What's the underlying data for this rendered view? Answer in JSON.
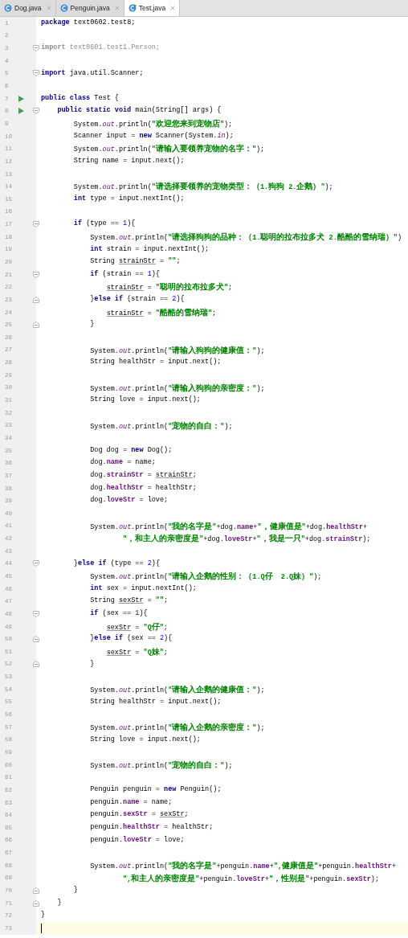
{
  "tabs": [
    {
      "label": "Dog.java",
      "selected": false,
      "kind": "class"
    },
    {
      "label": "Penguin.java",
      "selected": false,
      "kind": "class"
    },
    {
      "label": "Test.java",
      "selected": true,
      "kind": "runnable"
    }
  ],
  "lines": [
    {
      "n": "1",
      "current": false,
      "tokens": [
        {
          "kind": "kw",
          "text": "package"
        },
        {
          "kind": "p",
          "text": " text0602.test8;"
        }
      ]
    },
    {
      "n": "2",
      "current": false
    },
    {
      "n": "3",
      "current": false,
      "icons": [
        {
          "kind": "fold-start"
        }
      ],
      "tokens": [
        {
          "kind": "dimkw",
          "text": "import"
        },
        {
          "kind": "dim",
          "text": " text0601.test1.Person;"
        }
      ]
    },
    {
      "n": "4",
      "current": false
    },
    {
      "n": "5",
      "current": false,
      "icons": [
        {
          "kind": "fold-start"
        }
      ],
      "tokens": [
        {
          "kind": "kw",
          "text": "import"
        },
        {
          "kind": "p",
          "text": " java.util.Scanner;"
        }
      ]
    },
    {
      "n": "6",
      "current": false
    },
    {
      "n": "7",
      "current": false,
      "icons": [
        {
          "kind": "run"
        }
      ],
      "tokens": [
        {
          "kind": "kw",
          "text": "public class"
        },
        {
          "kind": "p",
          "text": " Test {"
        }
      ]
    },
    {
      "n": "8",
      "current": false,
      "icons": [
        {
          "kind": "run"
        },
        {
          "kind": "fold-start"
        }
      ],
      "tokens": [
        {
          "kind": "kw",
          "text": "    public static void"
        },
        {
          "kind": "p",
          "text": " main(String[] args) {"
        }
      ]
    },
    {
      "n": "9",
      "current": false,
      "tokens": [
        {
          "kind": "p",
          "text": "        System."
        },
        {
          "kind": "st",
          "text": "out"
        },
        {
          "kind": "p",
          "text": ".println("
        },
        {
          "kind": "str",
          "text": "\"欢迎您来到宠物店\""
        },
        {
          "kind": "p",
          "text": ");"
        }
      ]
    },
    {
      "n": "10",
      "current": false,
      "tokens": [
        {
          "kind": "p",
          "text": "        Scanner input = "
        },
        {
          "kind": "kw",
          "text": "new"
        },
        {
          "kind": "p",
          "text": " Scanner(System."
        },
        {
          "kind": "st",
          "text": "in"
        },
        {
          "kind": "p",
          "text": ");"
        }
      ]
    },
    {
      "n": "11",
      "current": false,
      "tokens": [
        {
          "kind": "p",
          "text": "        System."
        },
        {
          "kind": "st",
          "text": "out"
        },
        {
          "kind": "p",
          "text": ".println("
        },
        {
          "kind": "str",
          "text": "\"请输入要领养宠物的名字：\""
        },
        {
          "kind": "p",
          "text": ");"
        }
      ]
    },
    {
      "n": "12",
      "current": false,
      "tokens": [
        {
          "kind": "p",
          "text": "        String name = input.next();"
        }
      ]
    },
    {
      "n": "13",
      "current": false
    },
    {
      "n": "14",
      "current": false,
      "tokens": [
        {
          "kind": "p",
          "text": "        System."
        },
        {
          "kind": "st",
          "text": "out"
        },
        {
          "kind": "p",
          "text": ".println("
        },
        {
          "kind": "str",
          "text": "\"请选择要领养的宠物类型：（1.狗狗 2.企鹅）\""
        },
        {
          "kind": "p",
          "text": ");"
        }
      ]
    },
    {
      "n": "15",
      "current": false,
      "tokens": [
        {
          "kind": "kw",
          "text": "        int"
        },
        {
          "kind": "p",
          "text": " type = input.nextInt();"
        }
      ]
    },
    {
      "n": "16",
      "current": false
    },
    {
      "n": "17",
      "current": false,
      "icons": [
        {
          "kind": "fold-start"
        }
      ],
      "tokens": [
        {
          "kind": "kw",
          "text": "        if"
        },
        {
          "kind": "p",
          "text": " (type == "
        },
        {
          "kind": "num",
          "text": "1"
        },
        {
          "kind": "p",
          "text": "){"
        }
      ]
    },
    {
      "n": "18",
      "current": false,
      "tokens": [
        {
          "kind": "p",
          "text": "            System."
        },
        {
          "kind": "st",
          "text": "out"
        },
        {
          "kind": "p",
          "text": ".println("
        },
        {
          "kind": "str",
          "text": "\"请选择狗狗的品种：（1.聪明的拉布拉多犬 2.酷酷的雪纳瑞）\""
        },
        {
          "kind": "p",
          "text": ")"
        }
      ]
    },
    {
      "n": "19",
      "current": false,
      "tokens": [
        {
          "kind": "kw",
          "text": "            int"
        },
        {
          "kind": "p",
          "text": " strain = input.nextInt();"
        }
      ]
    },
    {
      "n": "20",
      "current": false,
      "tokens": [
        {
          "kind": "p",
          "text": "            String "
        },
        {
          "kind": "ul",
          "text": "strainStr"
        },
        {
          "kind": "p",
          "text": " = "
        },
        {
          "kind": "str",
          "text": "\"\""
        },
        {
          "kind": "p",
          "text": ";"
        }
      ]
    },
    {
      "n": "21",
      "current": false,
      "icons": [
        {
          "kind": "fold-start"
        }
      ],
      "tokens": [
        {
          "kind": "kw",
          "text": "            if"
        },
        {
          "kind": "p",
          "text": " (strain == "
        },
        {
          "kind": "num",
          "text": "1"
        },
        {
          "kind": "p",
          "text": "){"
        }
      ]
    },
    {
      "n": "22",
      "current": false,
      "tokens": [
        {
          "kind": "ul",
          "text": "                strainStr"
        },
        {
          "kind": "p",
          "text": " = "
        },
        {
          "kind": "str",
          "text": "\"聪明的拉布拉多犬\""
        },
        {
          "kind": "p",
          "text": ";"
        }
      ]
    },
    {
      "n": "23",
      "current": false,
      "icons": [
        {
          "kind": "fold-end"
        }
      ],
      "tokens": [
        {
          "kind": "p",
          "text": "            }"
        },
        {
          "kind": "kw",
          "text": "else if"
        },
        {
          "kind": "p",
          "text": " (strain == "
        },
        {
          "kind": "num",
          "text": "2"
        },
        {
          "kind": "p",
          "text": "){"
        }
      ]
    },
    {
      "n": "24",
      "current": false,
      "tokens": [
        {
          "kind": "ul",
          "text": "                strainStr"
        },
        {
          "kind": "p",
          "text": " = "
        },
        {
          "kind": "str",
          "text": "\"酷酷的雪纳瑞\""
        },
        {
          "kind": "p",
          "text": ";"
        }
      ]
    },
    {
      "n": "25",
      "current": false,
      "icons": [
        {
          "kind": "fold-end"
        }
      ],
      "tokens": [
        {
          "kind": "p",
          "text": "            }"
        }
      ]
    },
    {
      "n": "26",
      "current": false
    },
    {
      "n": "27",
      "current": false,
      "tokens": [
        {
          "kind": "p",
          "text": "            System."
        },
        {
          "kind": "st",
          "text": "out"
        },
        {
          "kind": "p",
          "text": ".println("
        },
        {
          "kind": "str",
          "text": "\"请输入狗狗的健康值：\""
        },
        {
          "kind": "p",
          "text": ");"
        }
      ]
    },
    {
      "n": "28",
      "current": false,
      "tokens": [
        {
          "kind": "p",
          "text": "            String healthStr = input.next();"
        }
      ]
    },
    {
      "n": "29",
      "current": false
    },
    {
      "n": "30",
      "current": false,
      "tokens": [
        {
          "kind": "p",
          "text": "            System."
        },
        {
          "kind": "st",
          "text": "out"
        },
        {
          "kind": "p",
          "text": ".println("
        },
        {
          "kind": "str",
          "text": "\"请输入狗狗的亲密度：\""
        },
        {
          "kind": "p",
          "text": ");"
        }
      ]
    },
    {
      "n": "31",
      "current": false,
      "tokens": [
        {
          "kind": "p",
          "text": "            String love = input.next();"
        }
      ]
    },
    {
      "n": "32",
      "current": false
    },
    {
      "n": "33",
      "current": false,
      "tokens": [
        {
          "kind": "p",
          "text": "            System."
        },
        {
          "kind": "st",
          "text": "out"
        },
        {
          "kind": "p",
          "text": ".println("
        },
        {
          "kind": "str",
          "text": "\"宠物的自白：\""
        },
        {
          "kind": "p",
          "text": ");"
        }
      ]
    },
    {
      "n": "34",
      "current": false
    },
    {
      "n": "35",
      "current": false,
      "tokens": [
        {
          "kind": "p",
          "text": "            Dog dog = "
        },
        {
          "kind": "kw",
          "text": "new"
        },
        {
          "kind": "p",
          "text": " Dog();"
        }
      ]
    },
    {
      "n": "36",
      "current": false,
      "tokens": [
        {
          "kind": "p",
          "text": "            dog."
        },
        {
          "kind": "fld",
          "text": "name"
        },
        {
          "kind": "p",
          "text": " = name;"
        }
      ]
    },
    {
      "n": "37",
      "current": false,
      "tokens": [
        {
          "kind": "p",
          "text": "            dog."
        },
        {
          "kind": "fld",
          "text": "strainStr"
        },
        {
          "kind": "p",
          "text": " = "
        },
        {
          "kind": "ul",
          "text": "strainStr"
        },
        {
          "kind": "p",
          "text": ";"
        }
      ]
    },
    {
      "n": "38",
      "current": false,
      "tokens": [
        {
          "kind": "p",
          "text": "            dog."
        },
        {
          "kind": "fld",
          "text": "healthStr"
        },
        {
          "kind": "p",
          "text": " = healthStr;"
        }
      ]
    },
    {
      "n": "39",
      "current": false,
      "tokens": [
        {
          "kind": "p",
          "text": "            dog."
        },
        {
          "kind": "fld",
          "text": "loveStr"
        },
        {
          "kind": "p",
          "text": " = love;"
        }
      ]
    },
    {
      "n": "40",
      "current": false
    },
    {
      "n": "41",
      "current": false,
      "tokens": [
        {
          "kind": "p",
          "text": "            System."
        },
        {
          "kind": "st",
          "text": "out"
        },
        {
          "kind": "p",
          "text": ".println("
        },
        {
          "kind": "str",
          "text": "\"我的名字是\""
        },
        {
          "kind": "p",
          "text": "+dog."
        },
        {
          "kind": "fld",
          "text": "name"
        },
        {
          "kind": "p",
          "text": "+"
        },
        {
          "kind": "str",
          "text": "\"，健康值是\""
        },
        {
          "kind": "p",
          "text": "+dog."
        },
        {
          "kind": "fld",
          "text": "healthStr"
        },
        {
          "kind": "p",
          "text": "+"
        }
      ]
    },
    {
      "n": "42",
      "current": false,
      "tokens": [
        {
          "kind": "str",
          "text": "                    \"，和主人的亲密度是\""
        },
        {
          "kind": "p",
          "text": "+dog."
        },
        {
          "kind": "fld",
          "text": "loveStr"
        },
        {
          "kind": "p",
          "text": "+"
        },
        {
          "kind": "str",
          "text": "\"，我是一只\""
        },
        {
          "kind": "p",
          "text": "+dog."
        },
        {
          "kind": "fld",
          "text": "strainStr"
        },
        {
          "kind": "p",
          "text": ");"
        }
      ]
    },
    {
      "n": "43",
      "current": false
    },
    {
      "n": "44",
      "current": false,
      "icons": [
        {
          "kind": "fold-start"
        }
      ],
      "tokens": [
        {
          "kind": "p",
          "text": "        }"
        },
        {
          "kind": "kw",
          "text": "else if"
        },
        {
          "kind": "p",
          "text": " (type == "
        },
        {
          "kind": "num",
          "text": "2"
        },
        {
          "kind": "p",
          "text": "){"
        }
      ]
    },
    {
      "n": "45",
      "current": false,
      "tokens": [
        {
          "kind": "p",
          "text": "            System."
        },
        {
          "kind": "st",
          "text": "out"
        },
        {
          "kind": "p",
          "text": ".println("
        },
        {
          "kind": "str",
          "text": "\"请输入企鹅的性别：（1.Q仔  2.Q妹）\""
        },
        {
          "kind": "p",
          "text": ");"
        }
      ]
    },
    {
      "n": "46",
      "current": false,
      "tokens": [
        {
          "kind": "kw",
          "text": "            int"
        },
        {
          "kind": "p",
          "text": " sex = input.nextInt();"
        }
      ]
    },
    {
      "n": "47",
      "current": false,
      "tokens": [
        {
          "kind": "p",
          "text": "            String "
        },
        {
          "kind": "ul",
          "text": "sexStr"
        },
        {
          "kind": "p",
          "text": " = "
        },
        {
          "kind": "str",
          "text": "\"\""
        },
        {
          "kind": "p",
          "text": ";"
        }
      ]
    },
    {
      "n": "48",
      "current": false,
      "icons": [
        {
          "kind": "fold-start"
        }
      ],
      "tokens": [
        {
          "kind": "kw",
          "text": "            if"
        },
        {
          "kind": "p",
          "text": " (sex == "
        },
        {
          "kind": "num",
          "text": "1"
        },
        {
          "kind": "p",
          "text": "){"
        }
      ]
    },
    {
      "n": "49",
      "current": false,
      "tokens": [
        {
          "kind": "ul",
          "text": "                sexStr"
        },
        {
          "kind": "p",
          "text": " = "
        },
        {
          "kind": "str",
          "text": "\"Q仔\""
        },
        {
          "kind": "p",
          "text": ";"
        }
      ]
    },
    {
      "n": "50",
      "current": false,
      "icons": [
        {
          "kind": "fold-end"
        }
      ],
      "tokens": [
        {
          "kind": "p",
          "text": "            }"
        },
        {
          "kind": "kw",
          "text": "else if"
        },
        {
          "kind": "p",
          "text": " (sex == "
        },
        {
          "kind": "num",
          "text": "2"
        },
        {
          "kind": "p",
          "text": "){"
        }
      ]
    },
    {
      "n": "51",
      "current": false,
      "tokens": [
        {
          "kind": "ul",
          "text": "                sexStr"
        },
        {
          "kind": "p",
          "text": " = "
        },
        {
          "kind": "str",
          "text": "\"Q妹\""
        },
        {
          "kind": "p",
          "text": ";"
        }
      ]
    },
    {
      "n": "52",
      "current": false,
      "icons": [
        {
          "kind": "fold-end"
        }
      ],
      "tokens": [
        {
          "kind": "p",
          "text": "            }"
        }
      ]
    },
    {
      "n": "53",
      "current": false
    },
    {
      "n": "54",
      "current": false,
      "tokens": [
        {
          "kind": "p",
          "text": "            System."
        },
        {
          "kind": "st",
          "text": "out"
        },
        {
          "kind": "p",
          "text": ".println("
        },
        {
          "kind": "str",
          "text": "\"请输入企鹅的健康值：\""
        },
        {
          "kind": "p",
          "text": ");"
        }
      ]
    },
    {
      "n": "55",
      "current": false,
      "tokens": [
        {
          "kind": "p",
          "text": "            String healthStr = input.next();"
        }
      ]
    },
    {
      "n": "56",
      "current": false
    },
    {
      "n": "57",
      "current": false,
      "tokens": [
        {
          "kind": "p",
          "text": "            System."
        },
        {
          "kind": "st",
          "text": "out"
        },
        {
          "kind": "p",
          "text": ".println("
        },
        {
          "kind": "str",
          "text": "\"请输入企鹅的亲密度：\""
        },
        {
          "kind": "p",
          "text": ");"
        }
      ]
    },
    {
      "n": "58",
      "current": false,
      "tokens": [
        {
          "kind": "p",
          "text": "            String love = input.next();"
        }
      ]
    },
    {
      "n": "59",
      "current": false
    },
    {
      "n": "60",
      "current": false,
      "tokens": [
        {
          "kind": "p",
          "text": "            System."
        },
        {
          "kind": "st",
          "text": "out"
        },
        {
          "kind": "p",
          "text": ".println("
        },
        {
          "kind": "str",
          "text": "\"宠物的自白：\""
        },
        {
          "kind": "p",
          "text": ");"
        }
      ]
    },
    {
      "n": "61",
      "current": false
    },
    {
      "n": "62",
      "current": false,
      "tokens": [
        {
          "kind": "p",
          "text": "            Penguin penguin = "
        },
        {
          "kind": "kw",
          "text": "new"
        },
        {
          "kind": "p",
          "text": " Penguin();"
        }
      ]
    },
    {
      "n": "63",
      "current": false,
      "tokens": [
        {
          "kind": "p",
          "text": "            penguin."
        },
        {
          "kind": "fld",
          "text": "name"
        },
        {
          "kind": "p",
          "text": " = name;"
        }
      ]
    },
    {
      "n": "64",
      "current": false,
      "tokens": [
        {
          "kind": "p",
          "text": "            penguin."
        },
        {
          "kind": "fld",
          "text": "sexStr"
        },
        {
          "kind": "p",
          "text": " = "
        },
        {
          "kind": "ul",
          "text": "sexStr"
        },
        {
          "kind": "p",
          "text": ";"
        }
      ]
    },
    {
      "n": "65",
      "current": false,
      "tokens": [
        {
          "kind": "p",
          "text": "            penguin."
        },
        {
          "kind": "fld",
          "text": "healthStr"
        },
        {
          "kind": "p",
          "text": " = healthStr;"
        }
      ]
    },
    {
      "n": "66",
      "current": false,
      "tokens": [
        {
          "kind": "p",
          "text": "            penguin."
        },
        {
          "kind": "fld",
          "text": "loveStr"
        },
        {
          "kind": "p",
          "text": " = love;"
        }
      ]
    },
    {
      "n": "67",
      "current": false
    },
    {
      "n": "68",
      "current": false,
      "tokens": [
        {
          "kind": "p",
          "text": "            System."
        },
        {
          "kind": "st",
          "text": "out"
        },
        {
          "kind": "p",
          "text": ".println("
        },
        {
          "kind": "str",
          "text": "\"我的名字是\""
        },
        {
          "kind": "p",
          "text": "+penguin."
        },
        {
          "kind": "fld",
          "text": "name"
        },
        {
          "kind": "p",
          "text": "+"
        },
        {
          "kind": "str",
          "text": "\",健康值是\""
        },
        {
          "kind": "p",
          "text": "+penguin."
        },
        {
          "kind": "fld",
          "text": "healthStr"
        },
        {
          "kind": "p",
          "text": "+"
        }
      ]
    },
    {
      "n": "69",
      "current": false,
      "tokens": [
        {
          "kind": "str",
          "text": "                    \",和主人的亲密度是\""
        },
        {
          "kind": "p",
          "text": "+penguin."
        },
        {
          "kind": "fld",
          "text": "loveStr"
        },
        {
          "kind": "p",
          "text": "+"
        },
        {
          "kind": "str",
          "text": "\"，性别是\""
        },
        {
          "kind": "p",
          "text": "+penguin."
        },
        {
          "kind": "fld",
          "text": "sexStr"
        },
        {
          "kind": "p",
          "text": ");"
        }
      ]
    },
    {
      "n": "70",
      "current": false,
      "icons": [
        {
          "kind": "fold-end"
        }
      ],
      "tokens": [
        {
          "kind": "p",
          "text": "        }"
        }
      ]
    },
    {
      "n": "71",
      "current": false,
      "icons": [
        {
          "kind": "fold-end"
        }
      ],
      "tokens": [
        {
          "kind": "p",
          "text": "    }"
        }
      ]
    },
    {
      "n": "72",
      "current": false,
      "tokens": [
        {
          "kind": "p",
          "text": "}"
        }
      ]
    },
    {
      "n": "73",
      "current": true
    }
  ]
}
